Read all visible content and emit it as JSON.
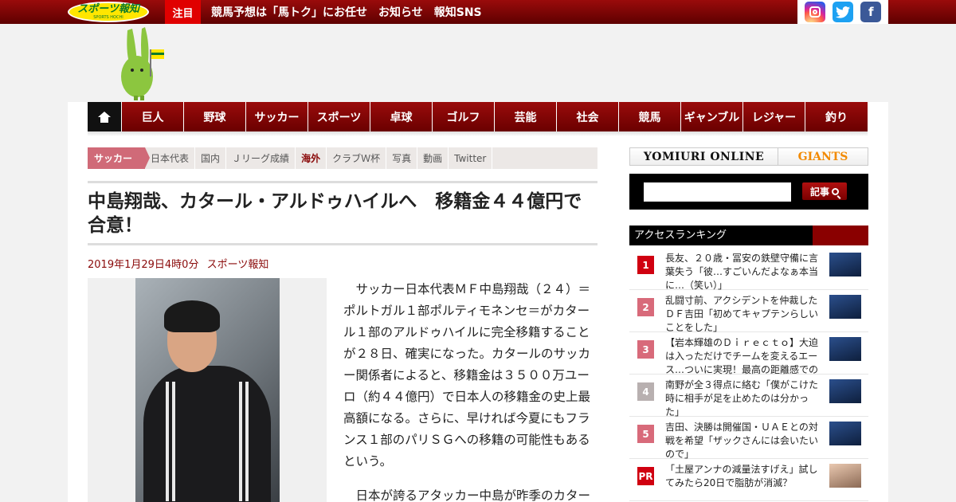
{
  "header": {
    "logo_text": "スポーツ報知",
    "logo_sub": "SPORTS HOCHI",
    "notice_label": "注目",
    "links": [
      "競馬予想は「馬トク」にお任せ",
      "お知らせ",
      "報知SNS"
    ],
    "sns": [
      {
        "name": "instagram-icon",
        "color": "#d6249f"
      },
      {
        "name": "twitter-icon",
        "color": "#1da1f2"
      },
      {
        "name": "facebook-icon",
        "color": "#3b5998",
        "glyph": "f"
      }
    ]
  },
  "nav": {
    "items": [
      "巨人",
      "野球",
      "サッカー",
      "スポーツ",
      "卓球",
      "ゴルフ",
      "芸能",
      "社会",
      "競馬",
      "ギャンブル",
      "レジャー",
      "釣り"
    ]
  },
  "subnav": {
    "section": "サッカー",
    "items": [
      "日本代表",
      "国内",
      "Ｊリーグ成績",
      "海外",
      "クラブＷ杯",
      "写真",
      "動画",
      "Twitter"
    ],
    "active": "海外"
  },
  "article": {
    "title": "中島翔哉、カタール・アルドゥハイルへ　移籍金４４億円で合意！",
    "date": "2019年1月29日4時0分",
    "source": "スポーツ報知",
    "paragraphs": [
      "サッカー日本代表ＭＦ中島翔哉（２４）＝ポルトガル１部ポルティモネンセ＝がカタール１部のアルドゥハイルに完全移籍することが２８日、確実になった。カタールのサッカー関係者によると、移籍金は３５００万ユーロ（約４４億円）で日本人の移籍金の史上最高額になる。さらに、早ければ今夏にもフランス１部のパリＳＧへの移籍の可能性もあるという。",
      "日本が誇るアタッカー中島が昨季のカター"
    ]
  },
  "sidebar": {
    "yomiuri": "YOMIURI ONLINE",
    "giants": "GIANTS",
    "search_button": "記事",
    "ranking_title": "アクセスランキング",
    "ranking": [
      {
        "num": "1",
        "text": "長友、２０歳・冨安の鉄壁守備に言葉失う「彼…すごいんだよなぁ本当に…（笑い）」",
        "color": "#d00010"
      },
      {
        "num": "2",
        "text": "乱闘寸前、アクシデントを仲裁したＤＦ吉田「初めてキャプテンらしいことをした」",
        "color": "#d86a7a"
      },
      {
        "num": "3",
        "text": "【岩本輝雄のＤｉｒｅｃｔｏ】大迫は入っただけでチームを変えるエース…ついに実現！最高の距離感での攻め",
        "color": "#d86a7a"
      },
      {
        "num": "4",
        "text": "南野が全３得点に絡む「僕がこけた時に相手が足を止めたのは分かった」",
        "color": "#b8b0b0"
      },
      {
        "num": "5",
        "text": "吉田、決勝は開催国・ＵＡＥとの対戦を希望「ザックさんには会いたいので」",
        "color": "#d86a7a"
      },
      {
        "num": "PR",
        "text": "「土屋アンナの減量法すげえ」試してみたら20日で脂肪が消滅？",
        "color": "#d00010"
      }
    ]
  }
}
